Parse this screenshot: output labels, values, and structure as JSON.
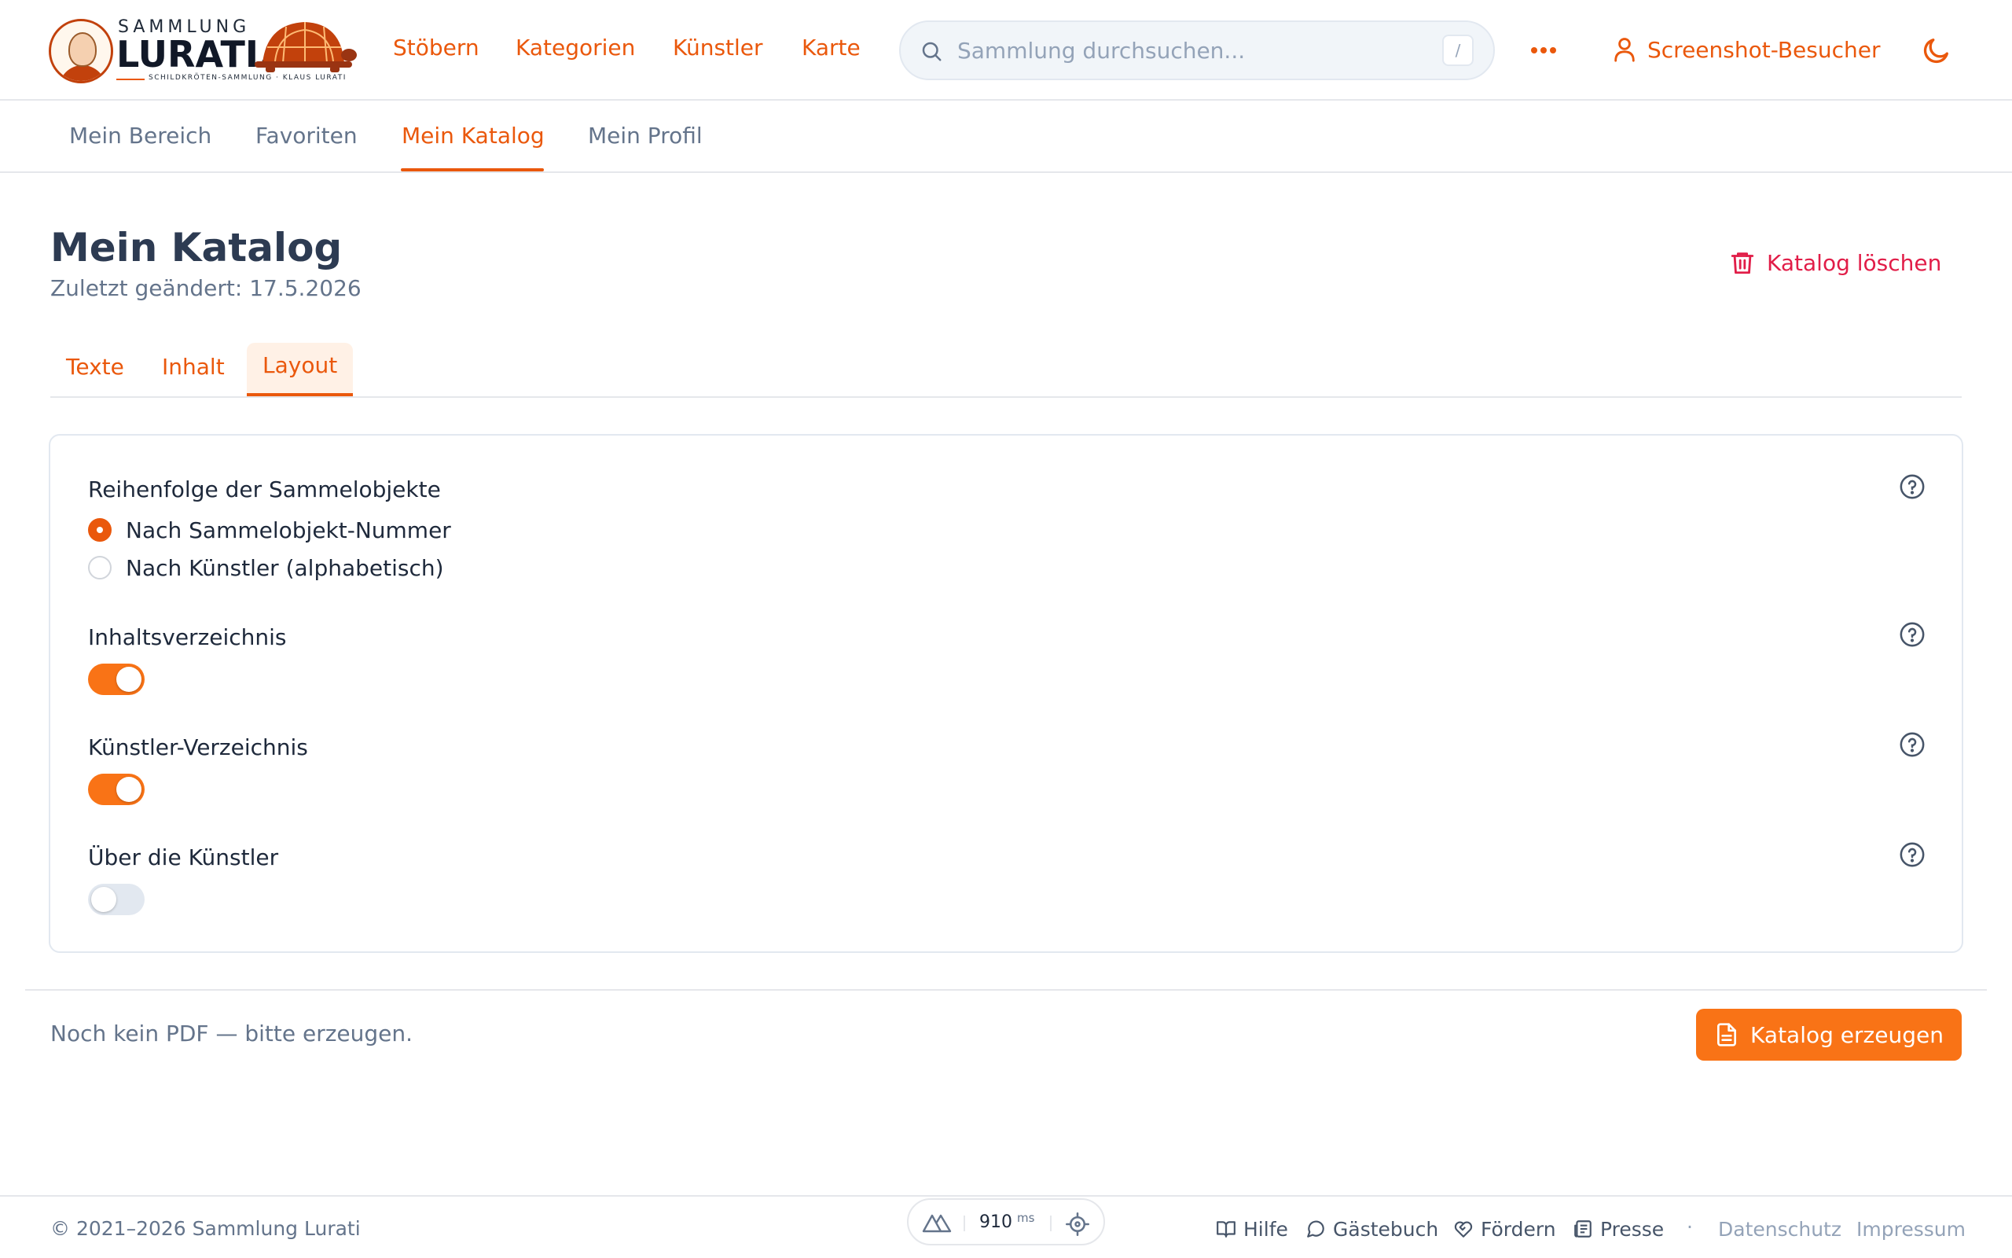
{
  "brand": {
    "top": "SAMMLUNG",
    "main": "LURATI.",
    "tagline": "SCHILDKRÖTEN-SAMMLUNG · KLAUS LURATI"
  },
  "nav": [
    "Stöbern",
    "Kategorien",
    "Künstler",
    "Karte"
  ],
  "search": {
    "placeholder": "Sammlung durchsuchen...",
    "shortcut": "/"
  },
  "user": {
    "label": "Screenshot-Besucher"
  },
  "subnav": {
    "items": [
      "Mein Bereich",
      "Favoriten",
      "Mein Katalog",
      "Mein Profil"
    ],
    "active": "Mein Katalog"
  },
  "page": {
    "title": "Mein Katalog",
    "subtitle": "Zuletzt geändert: 17.5.2026",
    "delete_label": "Katalog löschen"
  },
  "tabs": {
    "items": [
      "Texte",
      "Inhalt",
      "Layout"
    ],
    "active": "Layout"
  },
  "layout": {
    "order_label": "Reihenfolge der Sammelobjekte",
    "order_options": [
      "Nach Sammelobjekt-Nummer",
      "Nach Künstler (alphabetisch)"
    ],
    "order_selected": "Nach Sammelobjekt-Nummer",
    "toggles": [
      {
        "label": "Inhaltsverzeichnis",
        "on": true
      },
      {
        "label": "Künstler-Verzeichnis",
        "on": true
      },
      {
        "label": "Über die Künstler",
        "on": false
      }
    ]
  },
  "pdf": {
    "status": "Noch kein PDF — bitte erzeugen.",
    "generate_label": "Katalog erzeugen"
  },
  "footer": {
    "copyright": "© 2021–2026 Sammlung Lurati",
    "perf_value": "910",
    "perf_unit": "ms",
    "links": [
      "Hilfe",
      "Gästebuch",
      "Fördern",
      "Presse"
    ],
    "dot": "·",
    "legal": [
      "Datenschutz",
      "Impressum"
    ]
  },
  "colors": {
    "accent": "#f97316",
    "accent_text": "#ea580c",
    "danger": "#e11d48",
    "muted": "#64748b"
  }
}
